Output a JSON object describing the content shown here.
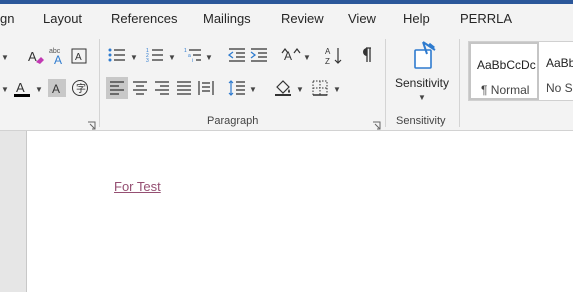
{
  "tabs": [
    "gn",
    "Layout",
    "References",
    "Mailings",
    "Review",
    "View",
    "Help",
    "PERRLA"
  ],
  "groups": {
    "paragraph": "Paragraph",
    "sensitivity": "Sensitivity"
  },
  "sensitivity_button": "Sensitivity",
  "styles": [
    {
      "sample": "AaBbCcDc",
      "name": "¶ Normal"
    },
    {
      "sample": "AaBbl",
      "name": "No Sp"
    }
  ],
  "document": {
    "link_text": "For Test"
  },
  "colors": {
    "accent": "#2b579a",
    "link": "#954f72",
    "font_color_bar": "#000000",
    "sensitivity_icon": "#2e7bcf"
  },
  "icons": [
    "clear-format-icon",
    "phonetic-guide-icon",
    "character-border-icon",
    "bullets-icon",
    "numbering-icon",
    "multilevel-list-icon",
    "decrease-indent-icon",
    "increase-indent-icon",
    "text-direction-icon",
    "sort-icon",
    "show-marks-icon",
    "font-color-icon",
    "character-shading-icon",
    "enclose-character-icon",
    "align-left-icon",
    "center-icon",
    "align-right-icon",
    "justify-icon",
    "distributed-icon",
    "line-spacing-icon",
    "shading-icon",
    "borders-icon",
    "sensitivity-icon"
  ]
}
